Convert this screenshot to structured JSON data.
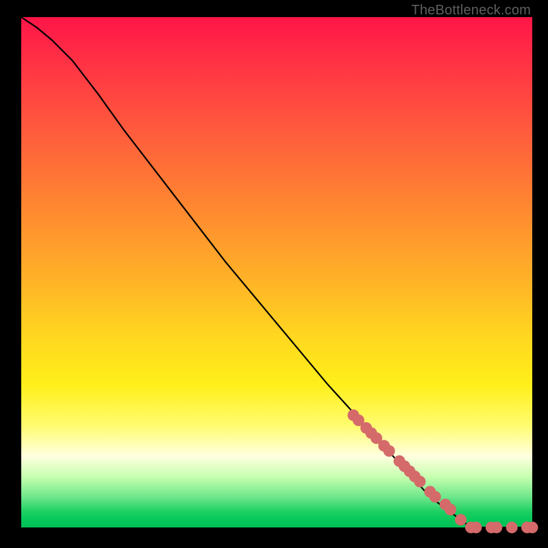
{
  "attribution": "TheBottleneck.com",
  "chart_data": {
    "type": "line",
    "title": "",
    "xlabel": "",
    "ylabel": "",
    "xlim": [
      0,
      100
    ],
    "ylim": [
      0,
      100
    ],
    "grid": false,
    "legend": false,
    "series": [
      {
        "name": "bottleneck-curve",
        "style": "line",
        "color": "#000000",
        "x": [
          0,
          3,
          6,
          10,
          15,
          20,
          30,
          40,
          50,
          60,
          70,
          80,
          88,
          92,
          96,
          100
        ],
        "values": [
          100,
          98,
          95.5,
          91.5,
          85,
          78,
          65,
          52,
          40,
          28,
          17,
          6,
          0,
          0,
          0,
          0
        ]
      },
      {
        "name": "data-points",
        "style": "scatter",
        "color": "#d46a6a",
        "x": [
          65,
          66,
          67.5,
          68.5,
          69.5,
          71,
          72,
          74,
          75,
          76,
          77,
          78,
          80,
          81,
          83,
          84,
          86,
          88,
          89,
          92,
          93,
          96,
          99,
          100
        ],
        "values": [
          22,
          21,
          19.5,
          18.5,
          17.5,
          16,
          15,
          13,
          12,
          11,
          10,
          9,
          7,
          6,
          4.5,
          3.5,
          1.5,
          0,
          0,
          0,
          0,
          0,
          0,
          0
        ]
      }
    ]
  }
}
